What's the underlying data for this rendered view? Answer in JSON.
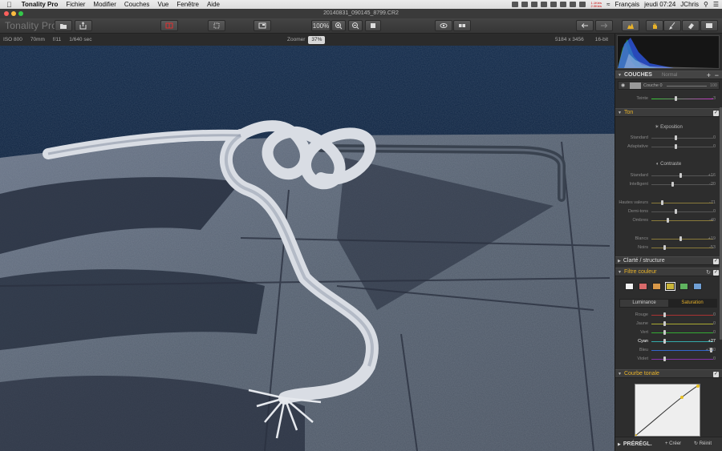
{
  "menubar": {
    "app": "Tonality Pro",
    "items": [
      "Fichier",
      "Modifier",
      "Couches",
      "Vue",
      "Fenêtre",
      "Aide"
    ],
    "net_up": "1.1Kb/s",
    "net_down": "2.0Kb/s",
    "language": "Français",
    "clock": "jeudi 07:24",
    "user": "JChris"
  },
  "window": {
    "title": "20140831_090145_8799.CR2"
  },
  "toolbar": {
    "app_title": "Tonality Pro",
    "zoom_value": "100%"
  },
  "infobar": {
    "iso": "ISO 800",
    "focal": "70mm",
    "aperture": "f/11",
    "shutter": "1/640 sec",
    "zoom_label": "Zoomer",
    "zoom_value": "37%",
    "dimensions": "5184 x 3456",
    "bitdepth": "16-bit"
  },
  "panel": {
    "layers": {
      "title": "COUCHES",
      "mode": "Normal",
      "layer_name": "Couche 0",
      "opacity": "100",
      "tint_label": "Teinte",
      "tint_value": "-3"
    },
    "tone": {
      "title": "Ton",
      "exposure": "Exposition",
      "standard_label": "Standard",
      "standard_value": "0",
      "adaptive_label": "Adaptative",
      "adaptive_value": "0",
      "contrast": "Contraste",
      "c_standard_label": "Standard",
      "c_standard_value": "+16",
      "c_intel_label": "Intelligent",
      "c_intel_value": "-20",
      "highlights_label": "Hautes valeurs",
      "highlights_value": "-71",
      "midtones_label": "Demi-tons",
      "midtones_value": "0",
      "shadows_label": "Ombres",
      "shadows_value": "-40",
      "whites_label": "Blancs",
      "whites_value": "+19",
      "blacks_label": "Noirs",
      "blacks_value": "-53"
    },
    "clarity": {
      "title": "Clarté / structure"
    },
    "color_filter": {
      "title": "Filtre couleur",
      "tab_luminance": "Luminance",
      "tab_saturation": "Saturation",
      "swatch_colors": [
        "#f2f2f2",
        "#d86a6a",
        "#d99848",
        "#c9b53a",
        "#5fb35f",
        "#6f9fd4"
      ],
      "rows": [
        {
          "label": "Rouge",
          "value": "0"
        },
        {
          "label": "Jaune",
          "value": "0"
        },
        {
          "label": "Vert",
          "value": "0"
        },
        {
          "label": "Cyan",
          "value": "+27"
        },
        {
          "label": "Bleu",
          "value": "+100"
        },
        {
          "label": "Violet",
          "value": "0"
        }
      ]
    },
    "curve": {
      "title": "Courbe tonale"
    },
    "presets": {
      "title": "PRÉRÉGL.",
      "create": "Créer",
      "reset": "Réinit"
    }
  },
  "colors": {
    "accent": "#e8b22a",
    "panel_bg": "#2d2d2d",
    "photo_sky": "#0c1a30"
  }
}
